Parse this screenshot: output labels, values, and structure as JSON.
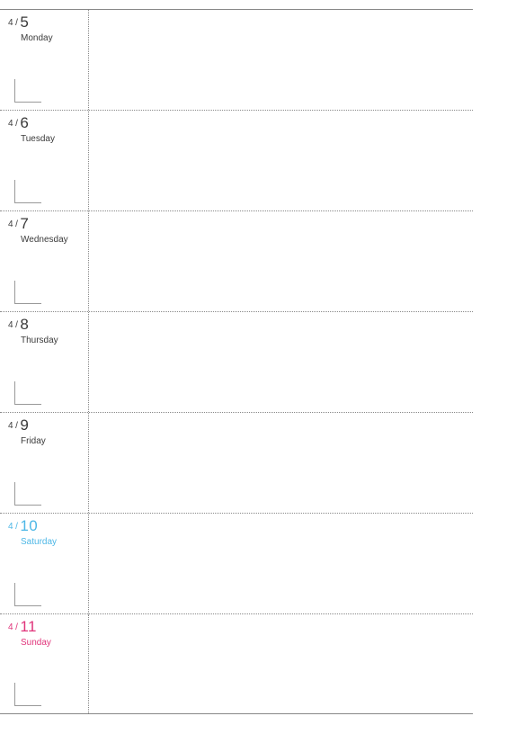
{
  "planner": {
    "days": [
      {
        "month": "4",
        "day": "5",
        "dow": "Monday",
        "style": "weekday"
      },
      {
        "month": "4",
        "day": "6",
        "dow": "Tuesday",
        "style": "weekday"
      },
      {
        "month": "4",
        "day": "7",
        "dow": "Wednesday",
        "style": "weekday"
      },
      {
        "month": "4",
        "day": "8",
        "dow": "Thursday",
        "style": "weekday"
      },
      {
        "month": "4",
        "day": "9",
        "dow": "Friday",
        "style": "weekday"
      },
      {
        "month": "4",
        "day": "10",
        "dow": "Saturday",
        "style": "saturday"
      },
      {
        "month": "4",
        "day": "11",
        "dow": "Sunday",
        "style": "sunday"
      }
    ]
  }
}
